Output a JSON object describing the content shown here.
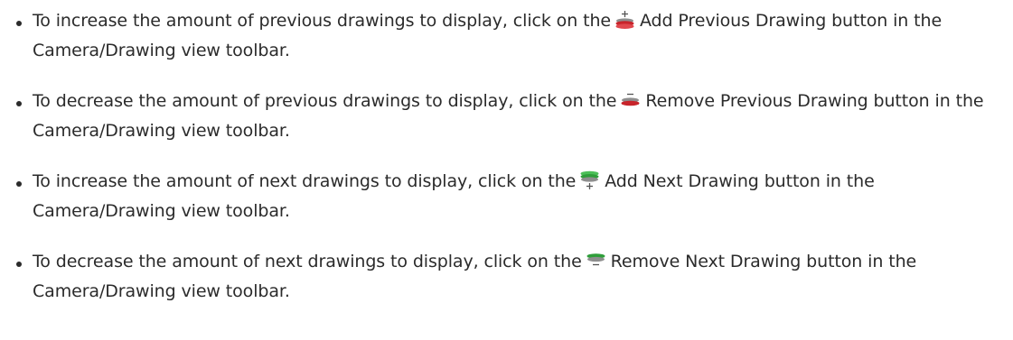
{
  "items": [
    {
      "before": "To increase the amount of previous drawings to display, click on the",
      "icon": "add-previous-drawing-icon",
      "after": "Add Previous Drawing button in the Camera/Drawing view toolbar."
    },
    {
      "before": "To decrease the amount of previous drawings to display, click on the",
      "icon": "remove-previous-drawing-icon",
      "after": "Remove Previous Drawing button in the Camera/Drawing view toolbar."
    },
    {
      "before": "To increase the amount of next drawings to display, click on the",
      "icon": "add-next-drawing-icon",
      "after": "Add Next Drawing button in the Camera/Drawing view toolbar."
    },
    {
      "before": "To decrease the amount of next drawings to display, click on the",
      "icon": "remove-next-drawing-icon",
      "after": "Remove Next Drawing button in the Camera/Drawing view toolbar."
    }
  ],
  "colors": {
    "text": "#2b2b2b",
    "onion_red": "#c8242b",
    "onion_green": "#2f9e3a",
    "disk_grey": "#8e8e8e"
  }
}
